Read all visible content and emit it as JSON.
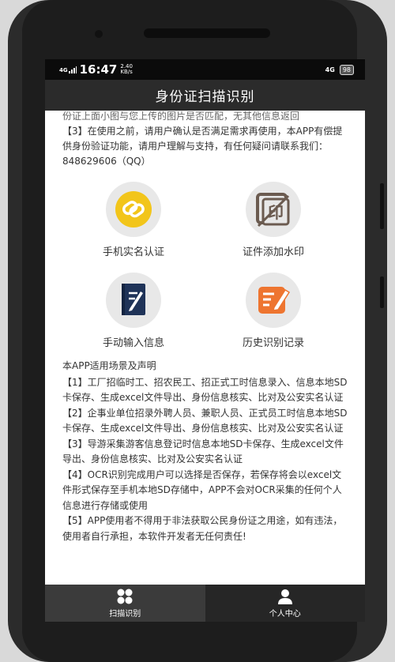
{
  "status_bar": {
    "signal": "4G",
    "time": "16:47",
    "speed": "2.40",
    "speed_unit": "KB/s",
    "network": "4G",
    "battery": "98"
  },
  "header": {
    "title": "身份证扫描识别"
  },
  "notice": {
    "partial_line": "份证上面小图与您上传的图片是否匹配，无其他信息返回",
    "item3": "【3】在使用之前，请用户确认是否满足需求再使用，本APP有偿提供身份验证功能，请用户理解与支持，有任何疑问请联系我们：848629606（QQ）"
  },
  "features": [
    {
      "label": "手机实名认证",
      "icon": "link-chain-icon",
      "icon_color": "#f2c51a"
    },
    {
      "label": "证件添加水印",
      "icon": "watermark-stamp-icon",
      "icon_color": "#6b5b50"
    },
    {
      "label": "手动输入信息",
      "icon": "pen-notebook-icon",
      "icon_color": "#1f3358"
    },
    {
      "label": "历史识别记录",
      "icon": "edit-document-icon",
      "icon_color": "#ee7530"
    }
  ],
  "scenes": {
    "heading": "本APP适用场景及声明",
    "items": [
      "【1】工厂招临时工、招农民工、招正式工时信息录入、信息本地SD卡保存、生成excel文件导出、身份信息核实、比对及公安实名认证",
      "【2】企事业单位招录外聘人员、兼职人员、正式员工时信息本地SD卡保存、生成excel文件导出、身份信息核实、比对及公安实名认证",
      "【3】导游采集游客信息登记时信息本地SD卡保存、生成excel文件导出、身份信息核实、比对及公安实名认证",
      "【4】OCR识别完成用户可以选择是否保存，若保存将会以excel文件形式保存至手机本地SD存储中，APP不会对OCR采集的任何个人信息进行存储或使用",
      "【5】APP使用者不得用于非法获取公民身份证之用途，如有违法，使用者自行承担，本软件开发者无任何责任!"
    ]
  },
  "tabs": [
    {
      "label": "扫描识别",
      "icon": "grid-icon",
      "active": true
    },
    {
      "label": "个人中心",
      "icon": "person-icon",
      "active": false
    }
  ]
}
